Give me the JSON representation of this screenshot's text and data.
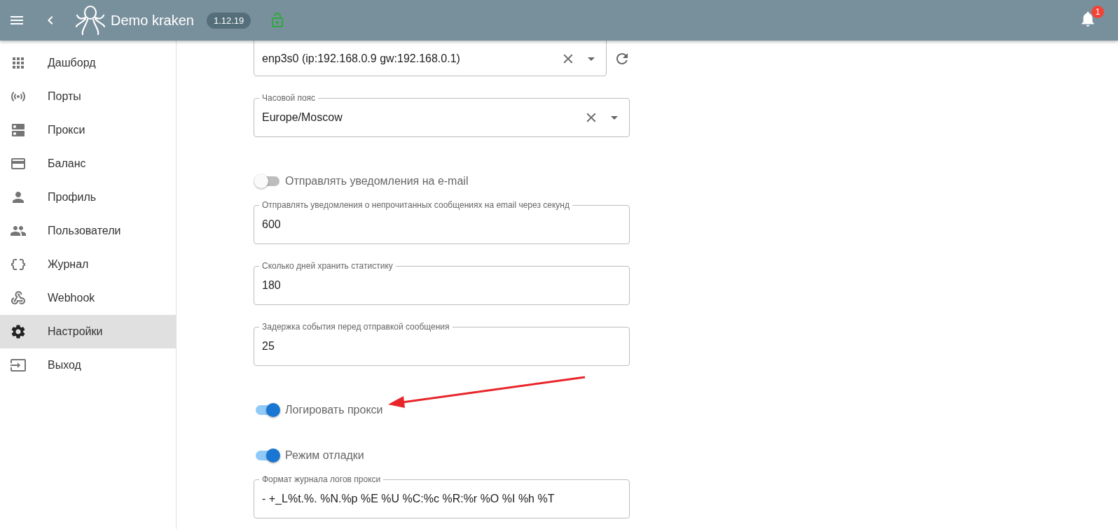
{
  "header": {
    "title": "Demo kraken",
    "version": "1.12.19",
    "notifications": "1"
  },
  "sidebar": {
    "items": [
      {
        "label": "Дашборд",
        "selected": false
      },
      {
        "label": "Порты",
        "selected": false
      },
      {
        "label": "Прокси",
        "selected": false
      },
      {
        "label": "Баланс",
        "selected": false
      },
      {
        "label": "Профиль",
        "selected": false
      },
      {
        "label": "Пользователи",
        "selected": false
      },
      {
        "label": "Журнал",
        "selected": false
      },
      {
        "label": "Webhook",
        "selected": false
      },
      {
        "label": "Настройки",
        "selected": true
      },
      {
        "label": "Выход",
        "selected": false
      }
    ]
  },
  "settings": [
    {
      "kind": "select",
      "value": "enp3s0 (ip:192.168.0.9 gw:192.168.0.1)",
      "refresh_button": true
    },
    {
      "kind": "select",
      "label": "Часовой пояс",
      "value": "Europe/Moscow",
      "refresh_button": false
    },
    {
      "kind": "toggle",
      "label": "Отправлять уведомления на e-mail",
      "on": false
    },
    {
      "kind": "text",
      "label": "Отправлять уведомления о непрочитанных сообщениях на email через секунд",
      "value": "600"
    },
    {
      "kind": "text",
      "label": "Сколько дней хранить статистику",
      "value": "180"
    },
    {
      "kind": "text",
      "label": "Задержка события перед отправкой сообщения",
      "value": "25"
    },
    {
      "kind": "toggle",
      "label": "Логировать прокси",
      "on": true
    },
    {
      "kind": "toggle",
      "label": "Режим отладки",
      "on": true
    },
    {
      "kind": "text",
      "label": "Формат журнала логов прокси",
      "value": "- +_L%t.%.  %N.%p %E %U %C:%c %R:%r %O %I %h %T"
    }
  ]
}
